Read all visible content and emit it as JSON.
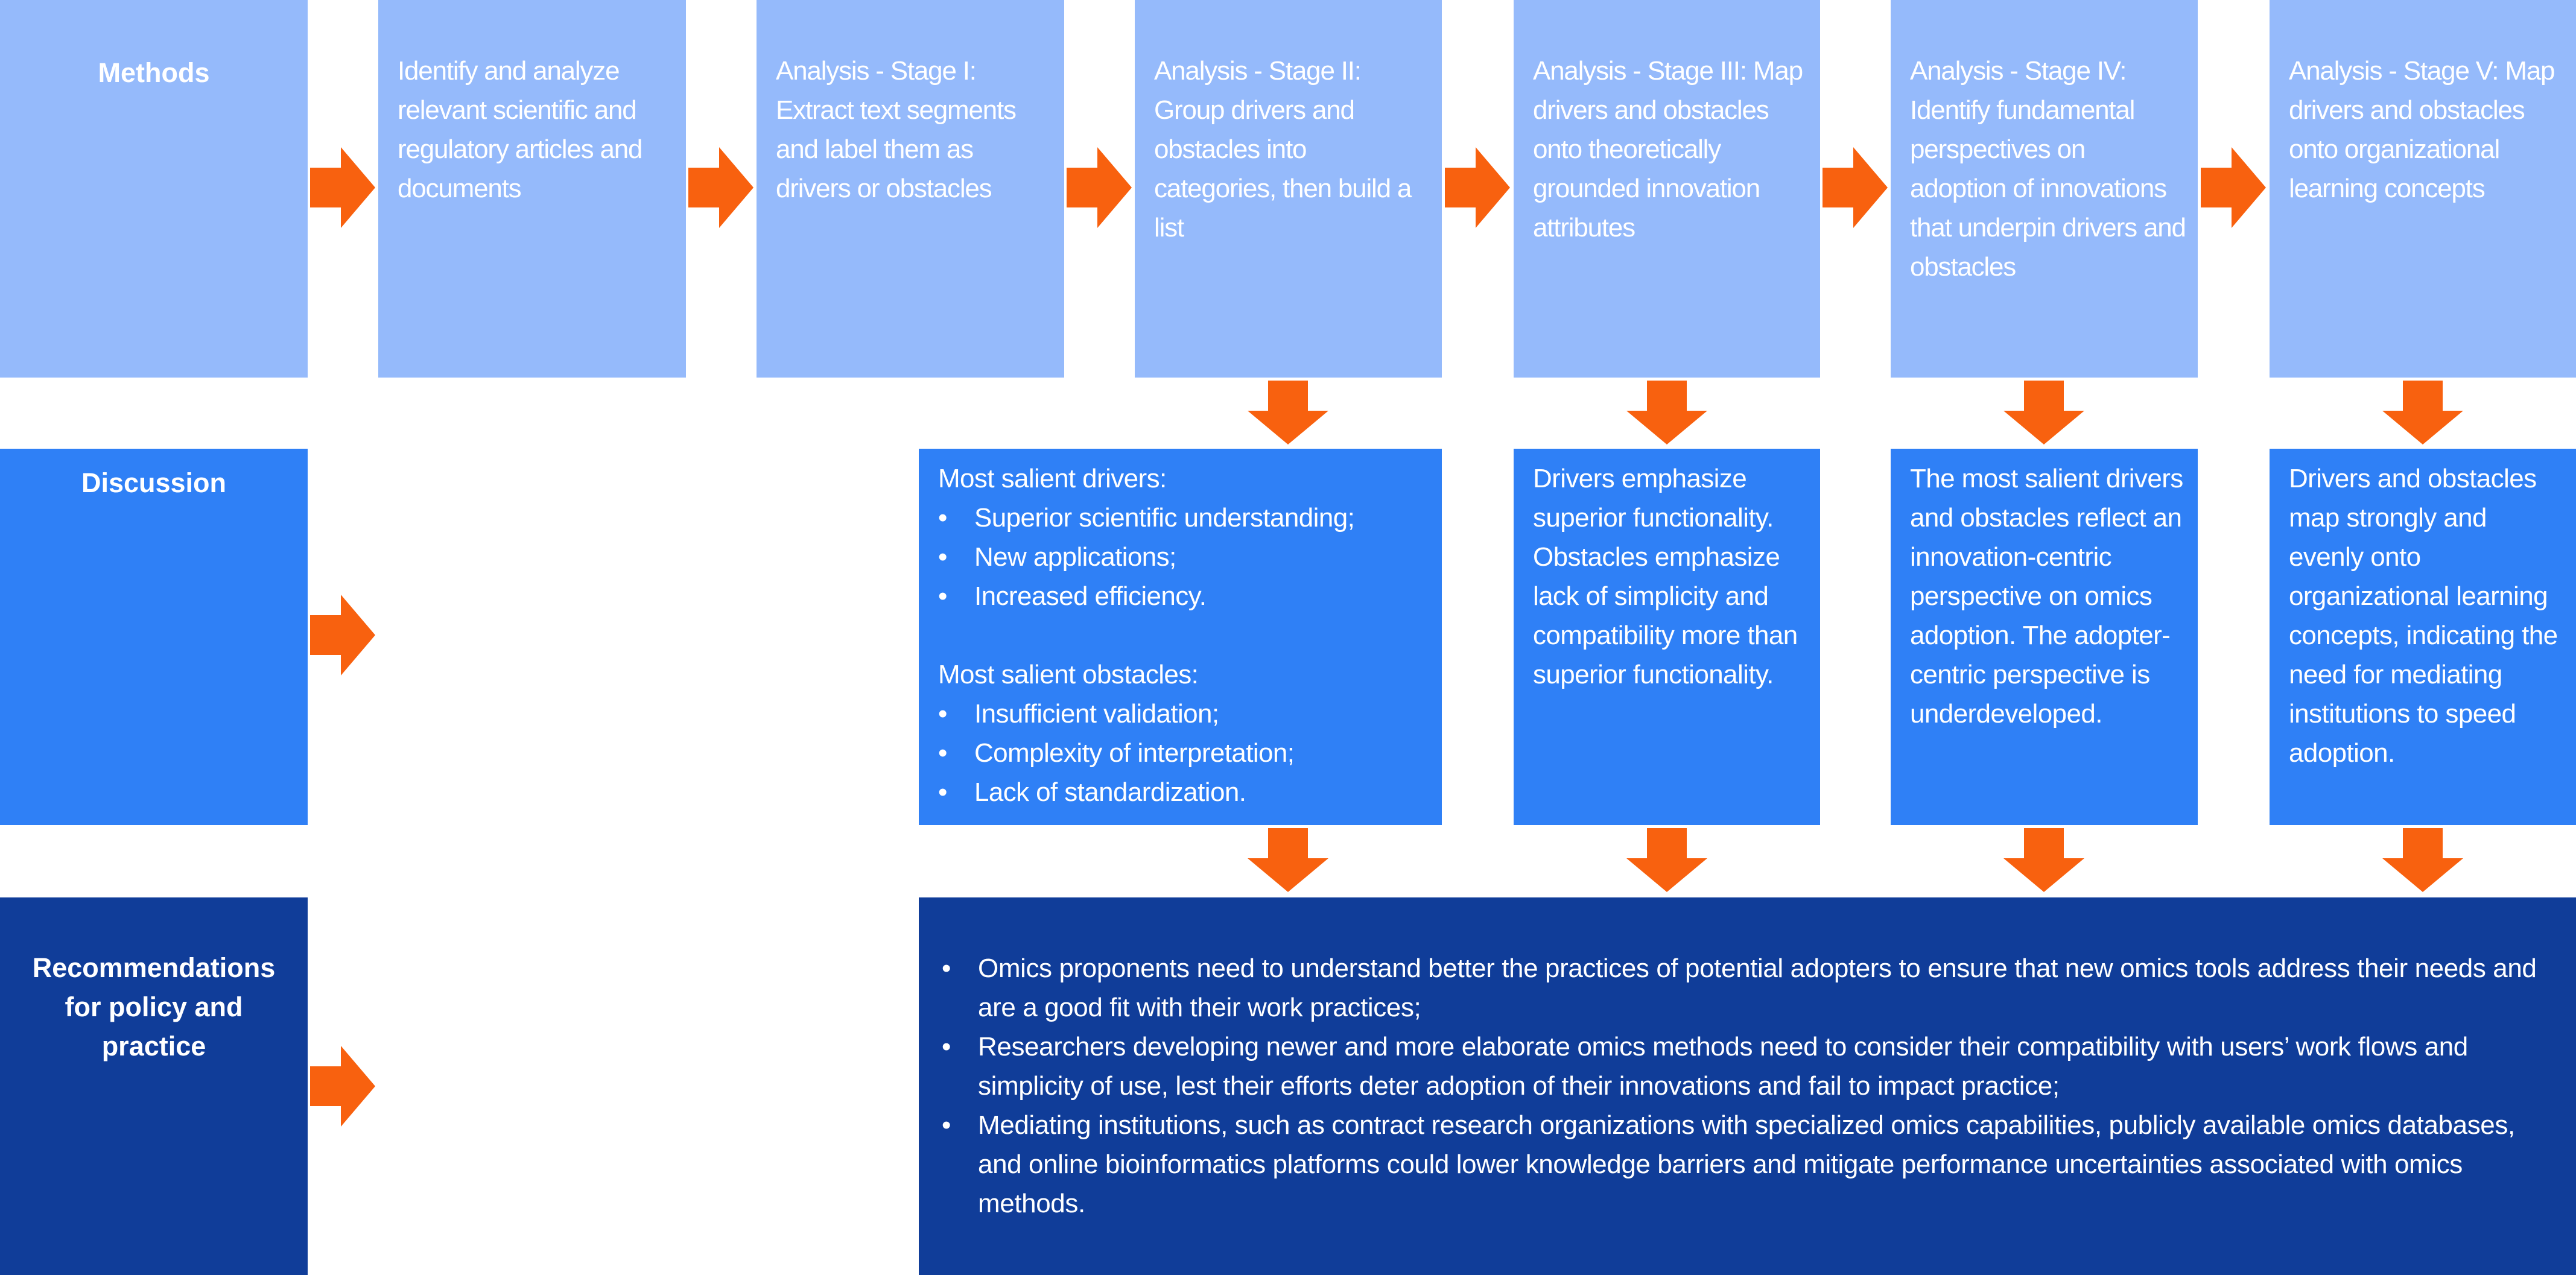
{
  "colors": {
    "methods_bg": "#95BAFB",
    "discussion_bg": "#2F80F6",
    "recommendations_bg": "#103D99",
    "arrow": "#F8610F",
    "text": "#FFFFFF"
  },
  "rows": {
    "methods": {
      "label": "Methods"
    },
    "discussion": {
      "label": "Discussion"
    },
    "recommendations": {
      "label": "Recommendations for policy and practice"
    }
  },
  "methods_steps": [
    {
      "text": "Identify and analyze relevant scientific and regulatory articles and documents"
    },
    {
      "text": "Analysis - Stage I: Extract text segments and label them as drivers or obstacles"
    },
    {
      "text": "Analysis - Stage II: Group drivers and obstacles into categories, then build a list"
    },
    {
      "text": "Analysis - Stage III: Map drivers and obstacles onto theoretically grounded innovation attributes"
    },
    {
      "text": "Analysis - Stage IV: Identify fundamental perspectives on adoption of innovations that underpin drivers and obstacles"
    },
    {
      "text": "Analysis - Stage V: Map drivers and obstacles onto organizational learning concepts"
    }
  ],
  "discussion": {
    "stage2": {
      "drivers_heading": "Most salient drivers:",
      "drivers": [
        "Superior scientific understanding;",
        "New applications;",
        "Increased efficiency."
      ],
      "obstacles_heading": "Most salient obstacles:",
      "obstacles": [
        "Insufficient validation;",
        "Complexity of interpretation;",
        "Lack of standardization."
      ]
    },
    "stage3": "Drivers emphasize superior functionality. Obstacles emphasize  lack of simplicity and compatibility more than superior functionality.",
    "stage4": "The most salient drivers and obstacles reflect an innovation-centric perspective on omics adoption. The adopter-centric perspective is underdeveloped.",
    "stage5": "Drivers and obstacles map strongly and evenly onto organizational learning concepts, indicating the need for mediating institutions to speed adoption."
  },
  "recommendations": [
    "Omics proponents need to understand better the practices of potential adopters to ensure that new omics tools address their needs and are a good fit with their work practices;",
    "Researchers developing newer and more elaborate omics methods need to consider their compatibility with users’ work flows and simplicity of use, lest their efforts deter adoption of their innovations and fail to impact practice;",
    "Mediating institutions, such as contract research organizations with specialized omics capabilities, publicly available omics databases, and online bioinformatics platforms could lower knowledge barriers and mitigate performance uncertainties associated with omics methods."
  ]
}
